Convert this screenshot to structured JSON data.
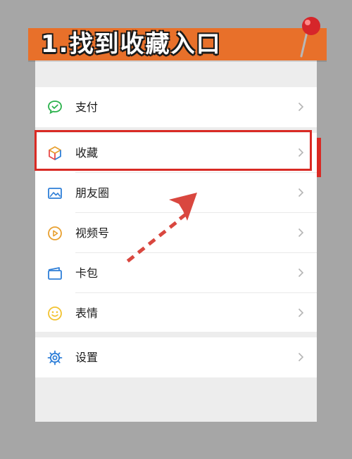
{
  "banner": {
    "title": "1.找到收藏入口"
  },
  "menu": {
    "items": [
      {
        "label": "支付",
        "icon": "wechat-pay-icon"
      },
      {
        "label": "收藏",
        "icon": "favorites-cube-icon"
      },
      {
        "label": "朋友圈",
        "icon": "moments-photo-icon"
      },
      {
        "label": "视频号",
        "icon": "channels-play-icon"
      },
      {
        "label": "卡包",
        "icon": "card-wallet-icon"
      },
      {
        "label": "表情",
        "icon": "sticker-smile-icon"
      },
      {
        "label": "设置",
        "icon": "settings-gear-icon"
      }
    ]
  },
  "colors": {
    "banner": "#e8702a",
    "highlight": "#d92a24",
    "accent_green": "#2bb24c",
    "accent_blue": "#2f7fd8",
    "accent_orange": "#e8a030",
    "accent_yellow": "#f2c230"
  }
}
